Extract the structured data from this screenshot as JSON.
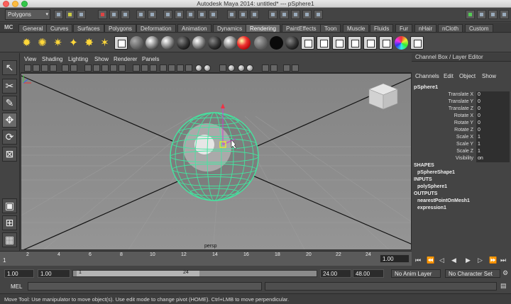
{
  "window": {
    "title": "Autodesk Maya 2014: untitled*   ---   pSphere1"
  },
  "status_line": {
    "menu_set": "Polygons"
  },
  "shelf": {
    "logo": "MC",
    "tabs": [
      "General",
      "Curves",
      "Surfaces",
      "Polygons",
      "Deformation",
      "Animation",
      "Dynamics",
      "Rendering",
      "PaintEffects",
      "Toon",
      "Muscle",
      "Fluids",
      "Fur",
      "nHair",
      "nCloth",
      "Custom"
    ],
    "active_tab": "Rendering"
  },
  "view_menu": [
    "View",
    "Shading",
    "Lighting",
    "Show",
    "Renderer",
    "Panels"
  ],
  "viewport": {
    "camera": "persp",
    "object": "pSphere1",
    "wire_color": "#43e6a0"
  },
  "channel_box": {
    "header": "Channel Box / Layer Editor",
    "menus": [
      "Channels",
      "Edit",
      "Object",
      "Show"
    ],
    "object": "pSphere1",
    "attributes": [
      {
        "name": "Translate X",
        "value": "0"
      },
      {
        "name": "Translate Y",
        "value": "0"
      },
      {
        "name": "Translate Z",
        "value": "0"
      },
      {
        "name": "Rotate X",
        "value": "0"
      },
      {
        "name": "Rotate Y",
        "value": "0"
      },
      {
        "name": "Rotate Z",
        "value": "0"
      },
      {
        "name": "Scale X",
        "value": "1"
      },
      {
        "name": "Scale Y",
        "value": "1"
      },
      {
        "name": "Scale Z",
        "value": "1"
      },
      {
        "name": "Visibility",
        "value": "on"
      }
    ],
    "shapes_label": "SHAPES",
    "shapes": [
      "pSphereShape1"
    ],
    "inputs_label": "INPUTS",
    "inputs": [
      "polySphere1"
    ],
    "outputs_label": "OUTPUTS",
    "outputs": [
      "nearestPointOnMesh1",
      "expression1"
    ]
  },
  "timeline": {
    "ticks": [
      "2",
      "4",
      "6",
      "8",
      "10",
      "12",
      "14",
      "16",
      "18",
      "20",
      "22",
      "24"
    ],
    "start_frame_label": "1",
    "current_frame": "1.00"
  },
  "range": {
    "start": "1.00",
    "playback_start": "1.00",
    "slider_start": "1",
    "slider_end": "24",
    "playback_end": "24.00",
    "end": "48.00",
    "anim_layer": "No Anim Layer",
    "character_set": "No Character Set"
  },
  "command_line": {
    "label": "MEL"
  },
  "help_line": "Move Tool: Use manipulator to move object(s). Use edit mode to change pivot (HOME). Ctrl+LMB to move perpendicular."
}
